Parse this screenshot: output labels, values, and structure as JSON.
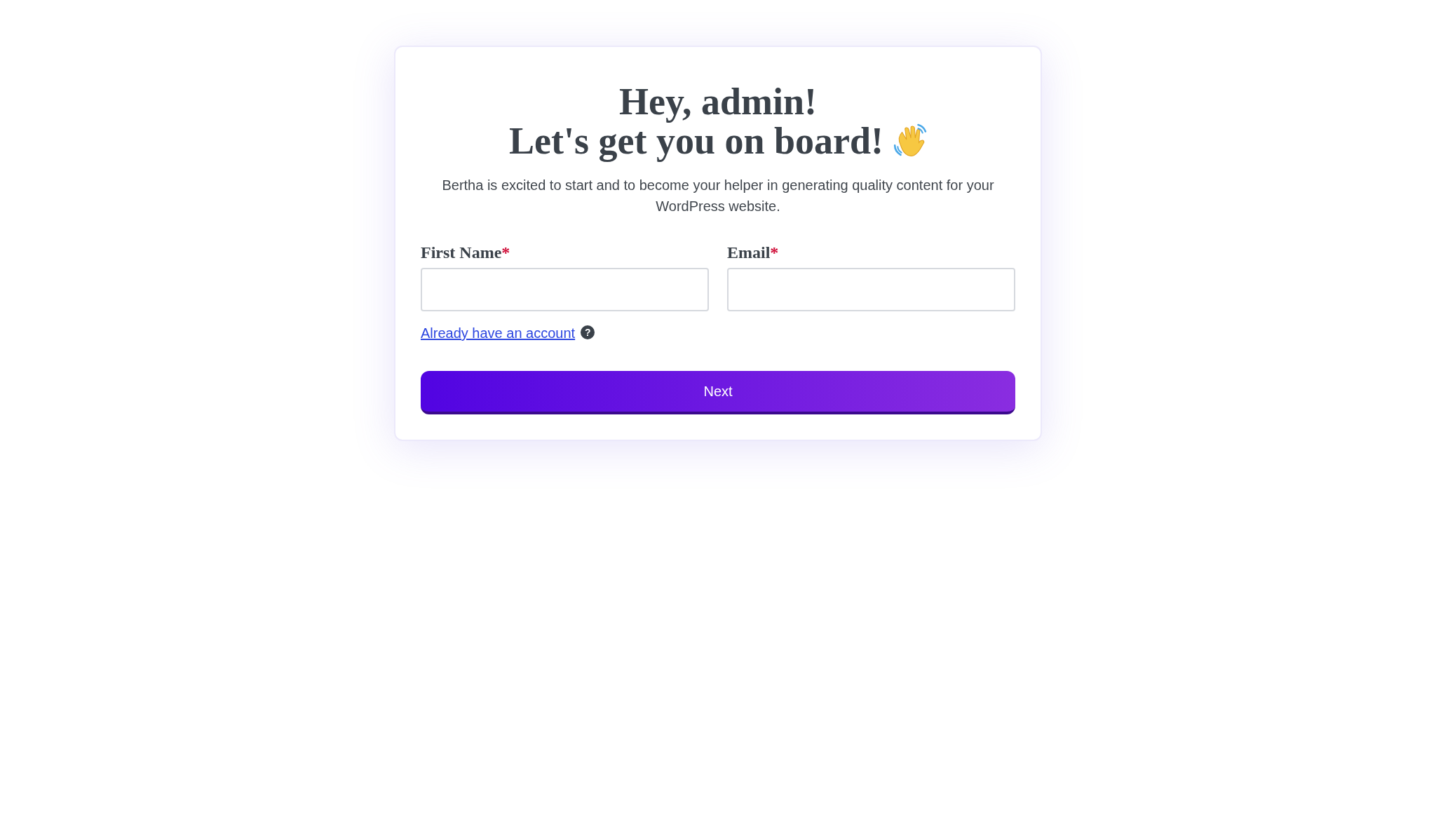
{
  "heading": {
    "line_1": "Hey, admin!",
    "line_2": "Let's get you on board!"
  },
  "intro": "Bertha is excited to start and to become your helper in generating quality content for your WordPress website.",
  "fields": [
    {
      "label": "First Name",
      "required_mark": "*"
    },
    {
      "label": "Email",
      "required_mark": "*"
    }
  ],
  "account_link": "Already have an account",
  "help_badge": "?",
  "next_button": "Next"
}
